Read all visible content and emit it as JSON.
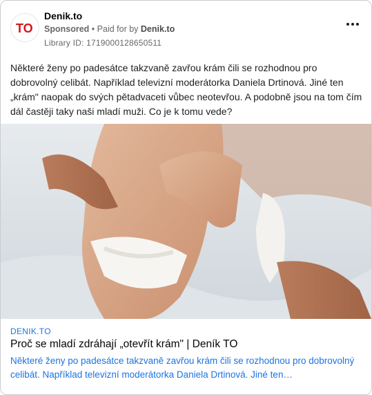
{
  "ad": {
    "page_name": "Denik.to",
    "sponsored": "Sponsored",
    "separator": "•",
    "paid_for_by": "Paid for by",
    "advertiser": "Denik.to",
    "library_id": "Library ID: 1719000128650511",
    "more_icon": "more-horizontal-icon",
    "logo_text": "TO",
    "logo_color": "#d7141a",
    "body": "Některé ženy po padesátce takzvaně zavřou krám čili se rozhodnou pro dobrovolný celibát. Například televizní moderátorka Daniela Drtinová. Jiné ten „krám\" naopak do svých pětadvaceti vůbec neotevřou. A podobně jsou na tom čím dál častěji taky naši mladí muži. Co je k tomu vede?"
  },
  "link": {
    "domain": "DENIK.TO",
    "title": "Proč se mladí zdráhají „otevřít krám\" | Deník TO",
    "description": "Některé ženy po padesátce takzvaně zavřou krám čili se rozhodnou pro dobrovolný celibát. Například televizní moderátorka Daniela Drtinová. Jiné ten…"
  },
  "colors": {
    "link_blue": "#1b74e4",
    "muted": "#65676b",
    "border": "#c9ccd1"
  }
}
